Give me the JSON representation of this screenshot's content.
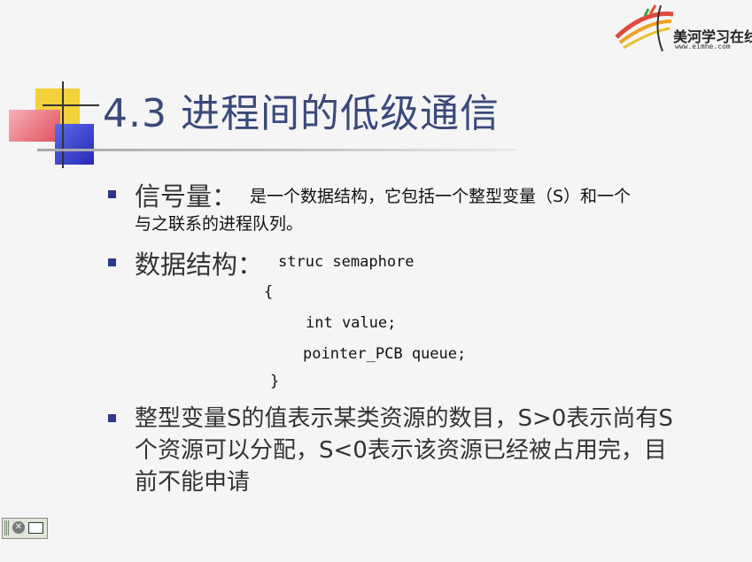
{
  "logo": {
    "name": "美河学习在线",
    "url": "www.eimhe.com"
  },
  "title": "4.3 进程间的低级通信",
  "bullets": [
    {
      "term": "信号量：",
      "line1": "是一个数据结构，它包括一个整型变量（S）和一个",
      "line2": "与之联系的进程队列。"
    },
    {
      "term": "数据结构：",
      "code_first": "struc semaphore",
      "code": [
        "{",
        "int value;",
        "pointer_PCB queue;",
        "}"
      ]
    },
    {
      "lines": [
        "整型变量S的值表示某类资源的数目，S>0表示尚有S",
        "个资源可以分配，S<0表示该资源已经被占用完，目",
        "前不能申请"
      ]
    }
  ],
  "colors": {
    "title": "#3a4a7a",
    "bullet": "#2b3a8c",
    "deco_yellow": "#f2d13a",
    "deco_red": "#e0505a",
    "deco_blue": "#3a3ad0"
  },
  "icons": [
    "stop-icon",
    "monitor-icon"
  ]
}
